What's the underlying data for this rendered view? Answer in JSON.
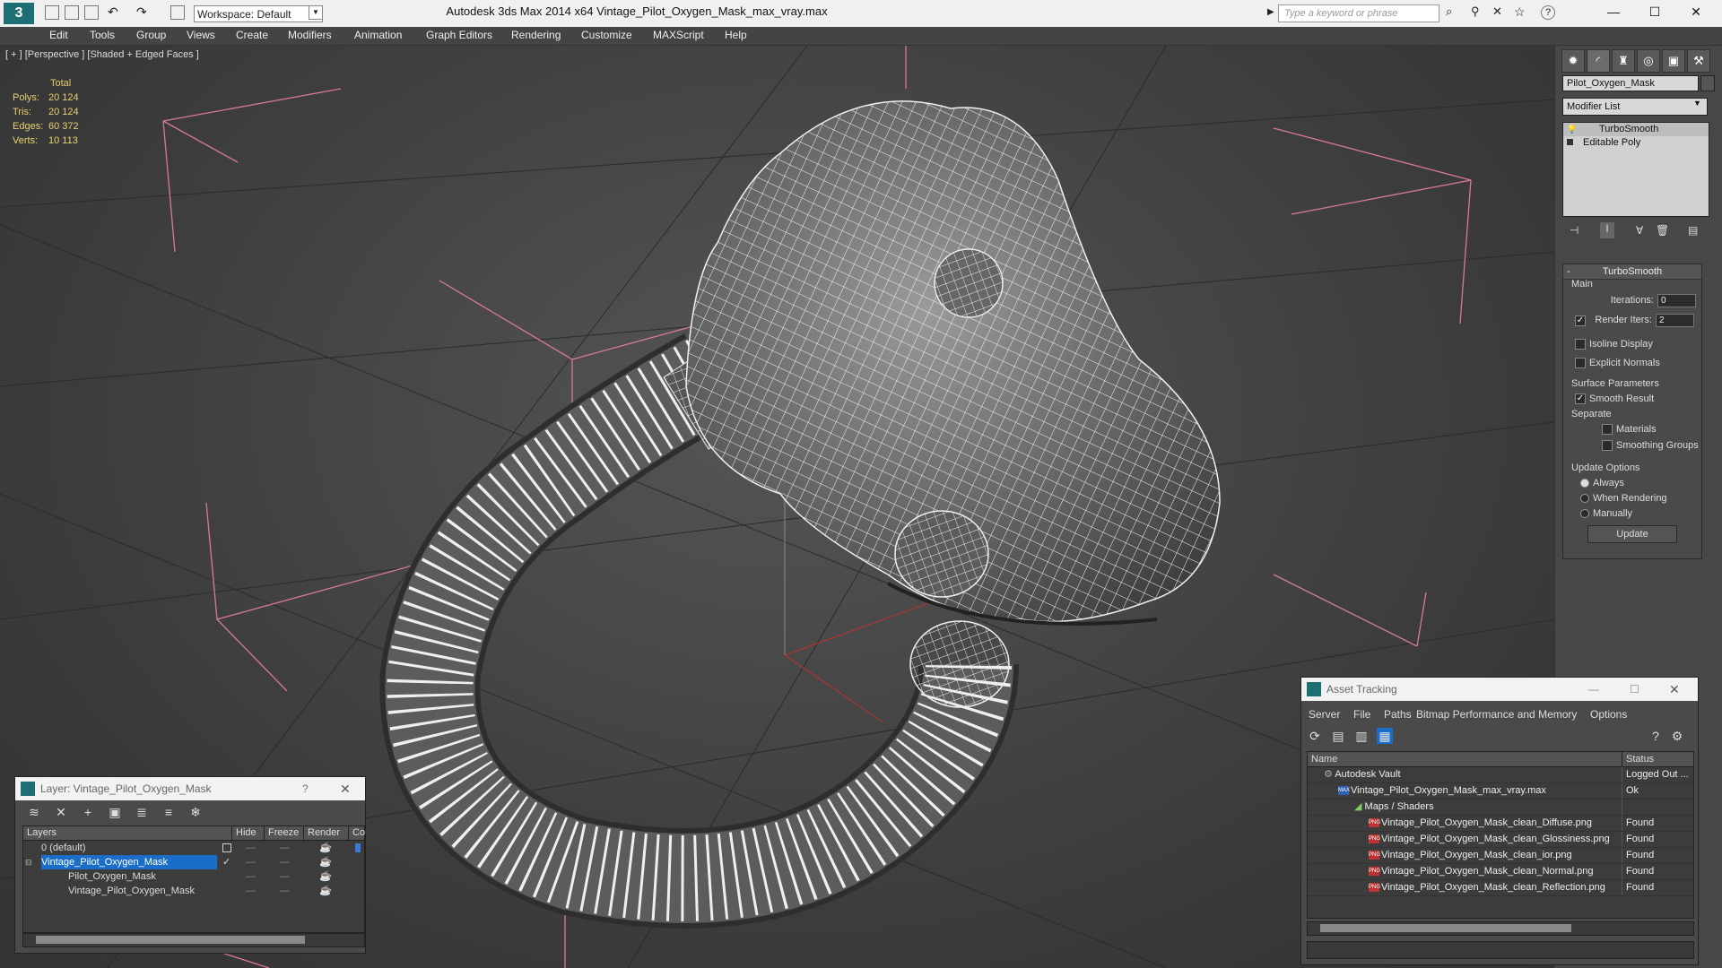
{
  "app": {
    "title": "Autodesk 3ds Max  2014 x64      Vintage_Pilot_Oxygen_Mask_max_vray.max",
    "workspace": "Workspace: Default",
    "search_placeholder": "Type a keyword or phrase"
  },
  "menu": [
    "Edit",
    "Tools",
    "Group",
    "Views",
    "Create",
    "Modifiers",
    "Animation",
    "Graph Editors",
    "Rendering",
    "Customize",
    "MAXScript",
    "Help"
  ],
  "viewport": {
    "label": "[ + ] [Perspective ] [Shaded + Edged Faces ]",
    "stats_header": "Total",
    "stats": [
      {
        "label": "Polys:",
        "value": "20 124"
      },
      {
        "label": "Tris:",
        "value": "20 124"
      },
      {
        "label": "Edges:",
        "value": "60 372"
      },
      {
        "label": "Verts:",
        "value": "10 113"
      }
    ]
  },
  "command_panel": {
    "object_name": "Pilot_Oxygen_Mask",
    "modifier_list": "Modifier List",
    "stack": [
      "TurboSmooth",
      "Editable Poly"
    ],
    "turbosmooth": {
      "title": "TurboSmooth",
      "main": "Main",
      "iterations_label": "Iterations:",
      "iterations": "0",
      "render_iters_label": "Render Iters:",
      "render_iters": "2",
      "isoline": "Isoline Display",
      "explicit": "Explicit Normals",
      "surface": "Surface Parameters",
      "smooth": "Smooth Result",
      "separate": "Separate",
      "materials": "Materials",
      "smoothing": "Smoothing Groups",
      "update_options": "Update Options",
      "always": "Always",
      "when_rendering": "When Rendering",
      "manually": "Manually",
      "update": "Update"
    }
  },
  "layer_window": {
    "title": "Layer: Vintage_Pilot_Oxygen_Mask",
    "help": "?",
    "columns": [
      "Layers",
      "Hide",
      "Freeze",
      "Render",
      "Co"
    ],
    "rows": [
      {
        "name": "0 (default)",
        "indent": 0
      },
      {
        "name": "Vintage_Pilot_Oxygen_Mask",
        "indent": 1
      },
      {
        "name": "Pilot_Oxygen_Mask",
        "indent": 2
      },
      {
        "name": "Vintage_Pilot_Oxygen_Mask",
        "indent": 2
      }
    ],
    "colors": [
      "#3a7bd5",
      "#9bd86a",
      "#222222",
      "#222222"
    ]
  },
  "asset_window": {
    "title": "Asset Tracking",
    "menu": [
      "Server",
      "File",
      "Paths",
      "Bitmap Performance and Memory",
      "Options"
    ],
    "columns": [
      "Name",
      "Status"
    ],
    "rows": [
      {
        "name": "Autodesk Vault",
        "status": "Logged Out ..."
      },
      {
        "name": "Vintage_Pilot_Oxygen_Mask_max_vray.max",
        "status": "Ok"
      },
      {
        "name": "Maps / Shaders",
        "status": ""
      },
      {
        "name": "Vintage_Pilot_Oxygen_Mask_clean_Diffuse.png",
        "status": "Found"
      },
      {
        "name": "Vintage_Pilot_Oxygen_Mask_clean_Glossiness.png",
        "status": "Found"
      },
      {
        "name": "Vintage_Pilot_Oxygen_Mask_clean_ior.png",
        "status": "Found"
      },
      {
        "name": "Vintage_Pilot_Oxygen_Mask_clean_Normal.png",
        "status": "Found"
      },
      {
        "name": "Vintage_Pilot_Oxygen_Mask_clean_Reflection.png",
        "status": "Found"
      }
    ]
  }
}
